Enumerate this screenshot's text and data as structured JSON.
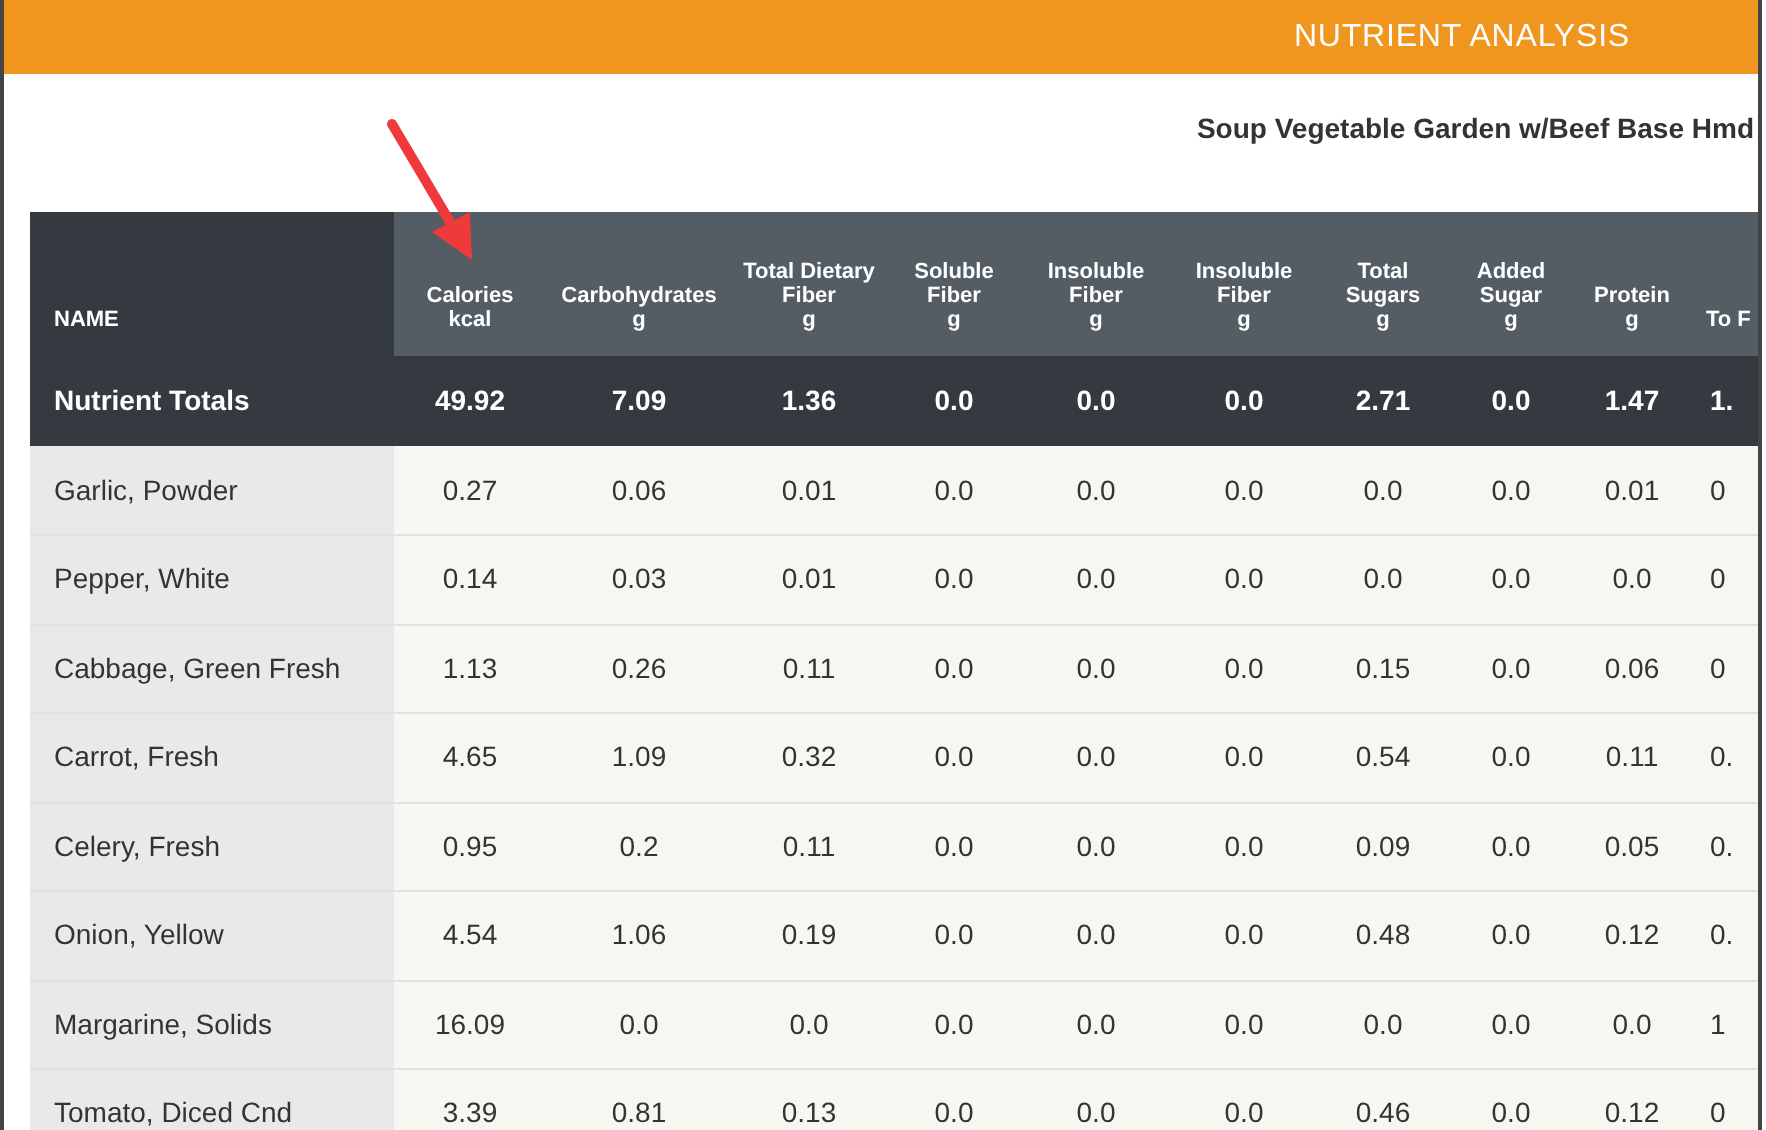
{
  "header": {
    "title": "NUTRIENT ANALYSIS"
  },
  "recipe_title": "Soup Vegetable Garden w/Beef Base Hmd",
  "table": {
    "columns": [
      {
        "label": "NAME"
      },
      {
        "label": "Calories",
        "unit": "kcal"
      },
      {
        "label": "Carbohydrates",
        "unit": "g"
      },
      {
        "label": "Total Dietary Fiber",
        "unit": "g"
      },
      {
        "label": "Soluble Fiber",
        "unit": "g"
      },
      {
        "label": "Insoluble Fiber",
        "unit": "g"
      },
      {
        "label": "Insoluble Fiber",
        "unit": "g"
      },
      {
        "label": "Total Sugars",
        "unit": "g"
      },
      {
        "label": "Added Sugar",
        "unit": "g"
      },
      {
        "label": "Protein",
        "unit": "g"
      },
      {
        "label": "To F"
      }
    ],
    "totals": {
      "name": "Nutrient Totals",
      "values": [
        "49.92",
        "7.09",
        "1.36",
        "0.0",
        "0.0",
        "0.0",
        "2.71",
        "0.0",
        "1.47",
        "1."
      ]
    },
    "rows": [
      {
        "name": "Garlic, Powder",
        "values": [
          "0.27",
          "0.06",
          "0.01",
          "0.0",
          "0.0",
          "0.0",
          "0.0",
          "0.0",
          "0.01",
          "0"
        ]
      },
      {
        "name": "Pepper, White",
        "values": [
          "0.14",
          "0.03",
          "0.01",
          "0.0",
          "0.0",
          "0.0",
          "0.0",
          "0.0",
          "0.0",
          "0"
        ]
      },
      {
        "name": "Cabbage, Green Fresh",
        "values": [
          "1.13",
          "0.26",
          "0.11",
          "0.0",
          "0.0",
          "0.0",
          "0.15",
          "0.0",
          "0.06",
          "0"
        ]
      },
      {
        "name": "Carrot, Fresh",
        "values": [
          "4.65",
          "1.09",
          "0.32",
          "0.0",
          "0.0",
          "0.0",
          "0.54",
          "0.0",
          "0.11",
          "0."
        ]
      },
      {
        "name": "Celery, Fresh",
        "values": [
          "0.95",
          "0.2",
          "0.11",
          "0.0",
          "0.0",
          "0.0",
          "0.09",
          "0.0",
          "0.05",
          "0."
        ]
      },
      {
        "name": "Onion, Yellow",
        "values": [
          "4.54",
          "1.06",
          "0.19",
          "0.0",
          "0.0",
          "0.0",
          "0.48",
          "0.0",
          "0.12",
          "0."
        ]
      },
      {
        "name": "Margarine, Solids",
        "values": [
          "16.09",
          "0.0",
          "0.0",
          "0.0",
          "0.0",
          "0.0",
          "0.0",
          "0.0",
          "0.0",
          "1"
        ]
      },
      {
        "name": "Tomato, Diced Cnd",
        "values": [
          "3.39",
          "0.81",
          "0.13",
          "0.0",
          "0.0",
          "0.0",
          "0.46",
          "0.0",
          "0.12",
          "0"
        ]
      }
    ]
  }
}
